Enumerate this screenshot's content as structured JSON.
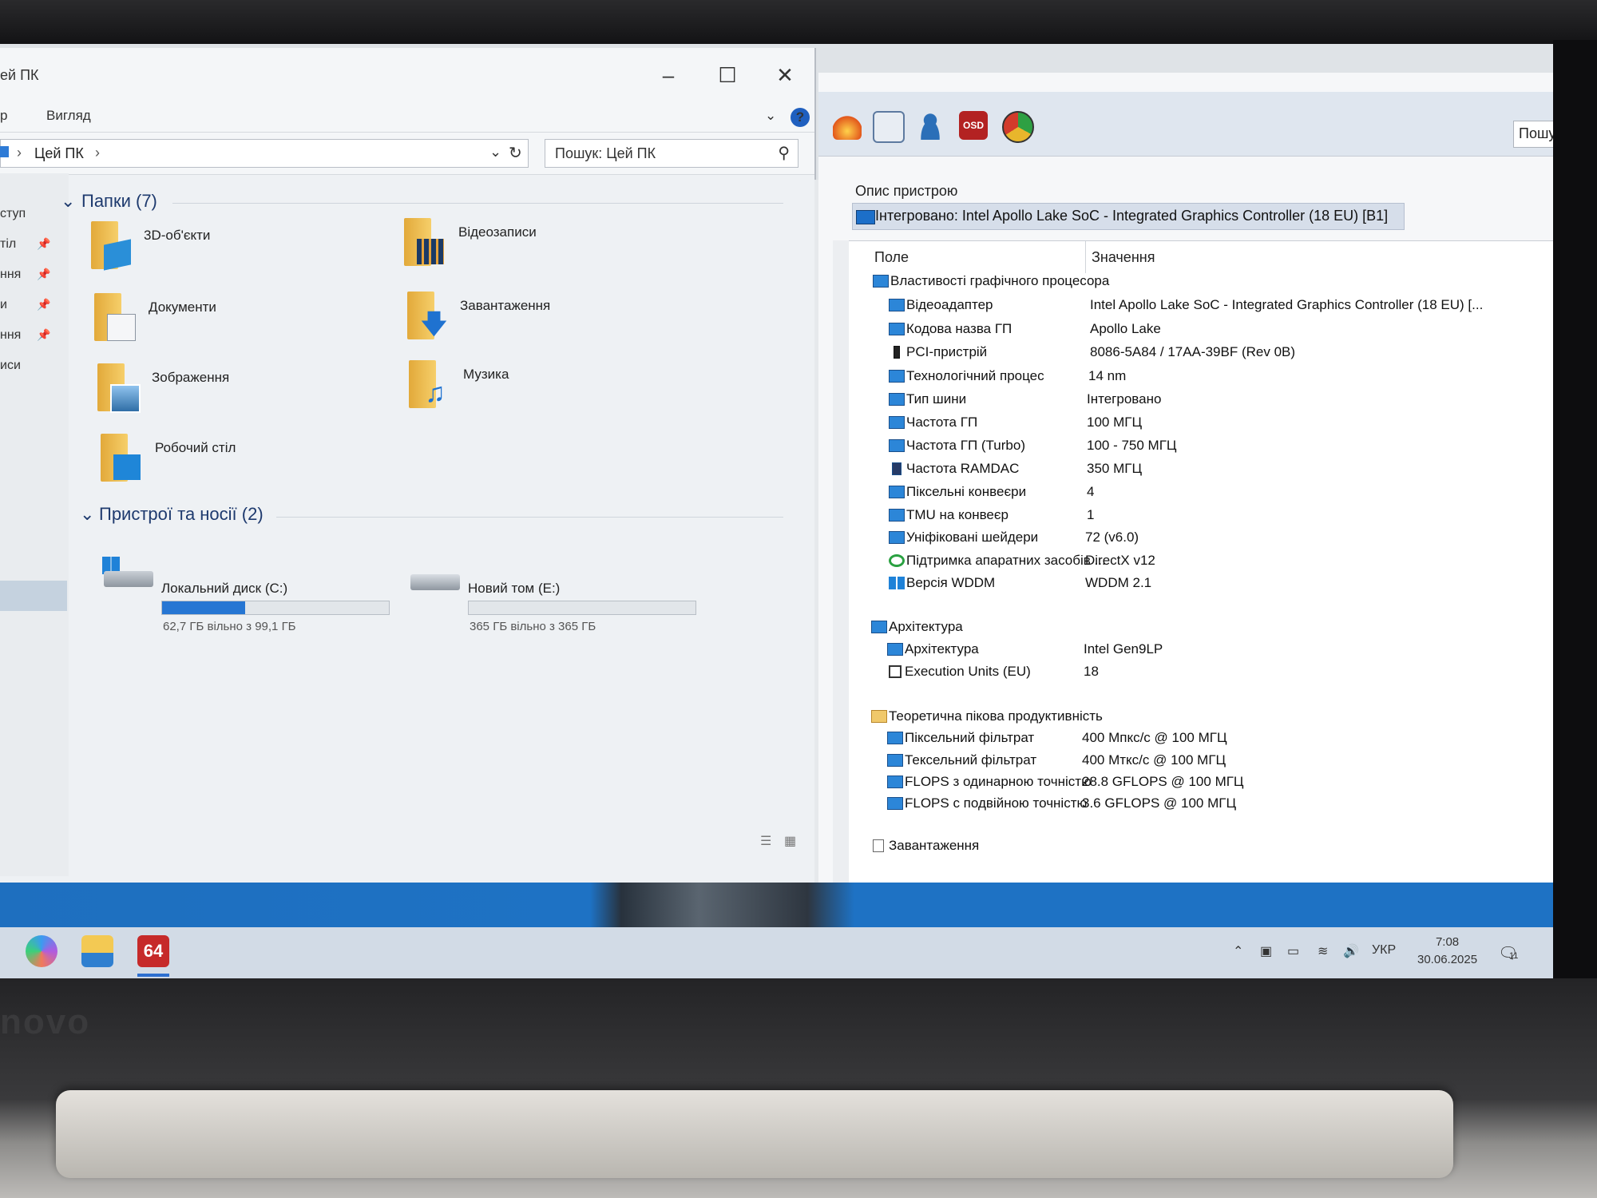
{
  "explorer": {
    "title": "ей ПК",
    "ribbon": {
      "left": "р",
      "view": "Вигляд"
    },
    "address": {
      "crumb": "Цей ПК"
    },
    "search": {
      "placeholder": "Пошук: Цей ПК"
    },
    "nav": [
      {
        "label": "ступ",
        "pinned": false
      },
      {
        "label": "тіл",
        "pinned": true
      },
      {
        "label": "ння",
        "pinned": true
      },
      {
        "label": "и",
        "pinned": true
      },
      {
        "label": "ння",
        "pinned": true
      },
      {
        "label": "иси",
        "pinned": false
      }
    ],
    "folders_header": "Папки (7)",
    "folders": [
      {
        "label": "3D-об'єкти",
        "icon": "3d-objects-icon"
      },
      {
        "label": "Відеозаписи",
        "icon": "videos-icon"
      },
      {
        "label": "Документи",
        "icon": "documents-icon"
      },
      {
        "label": "Завантаження",
        "icon": "downloads-icon"
      },
      {
        "label": "Зображення",
        "icon": "pictures-icon"
      },
      {
        "label": "Музика",
        "icon": "music-icon"
      },
      {
        "label": "Робочий стіл",
        "icon": "desktop-icon"
      }
    ],
    "devices_header": "Пристрої та носії (2)",
    "drives": [
      {
        "label": "Локальний диск (C:)",
        "free": "62,7 ГБ вільно з 99,1 ГБ",
        "used_fraction": 0.367
      },
      {
        "label": "Новий том (E:)",
        "free": "365 ГБ вільно з 365 ГБ",
        "used_fraction": 0.0
      }
    ]
  },
  "aida": {
    "search_label": "Пошук",
    "toolbar_icons": [
      "flame-icon",
      "report-icon",
      "user-icon",
      "osd-icon",
      "gauge-icon"
    ],
    "osd_label": "OSD",
    "device_description_label": "Опис пристрою",
    "device_description": "Інтегровано: Intel Apollo Lake SoC - Integrated Graphics Controller (18 EU) [B1]",
    "columns": {
      "field": "Поле",
      "value": "Значення"
    },
    "sections": [
      {
        "title": "Властивості графічного процесора",
        "rows": [
          {
            "k": "Відеоадаптер",
            "v": "Intel Apollo Lake SoC - Integrated Graphics Controller (18 EU) [..."
          },
          {
            "k": "Кодова назва ГП",
            "v": "Apollo Lake"
          },
          {
            "k": "PCI-пристрій",
            "v": "8086-5A84 / 17AA-39BF  (Rev 0B)"
          },
          {
            "k": "Технологічний процес",
            "v": "14 nm"
          },
          {
            "k": "Тип шини",
            "v": "Інтегровано"
          },
          {
            "k": "Частота ГП",
            "v": "100 МГЦ"
          },
          {
            "k": "Частота ГП (Turbo)",
            "v": "100 - 750 МГЦ"
          },
          {
            "k": "Частота RAMDAC",
            "v": "350 МГЦ"
          },
          {
            "k": "Піксельні конвеєри",
            "v": "4"
          },
          {
            "k": "TMU на конвеєр",
            "v": "1"
          },
          {
            "k": "Уніфіковані шейдери",
            "v": "72  (v6.0)"
          },
          {
            "k": "Підтримка апаратних засобів ...",
            "v": "DirectX v12"
          },
          {
            "k": "Версія WDDM",
            "v": "WDDM 2.1"
          }
        ]
      },
      {
        "title": "Архітектура",
        "rows": [
          {
            "k": "Архітектура",
            "v": "Intel Gen9LP"
          },
          {
            "k": "Execution Units (EU)",
            "v": "18"
          }
        ]
      },
      {
        "title": "Теоретична пікова продуктивність",
        "rows": [
          {
            "k": "Піксельний фільтрат",
            "v": "400 Мпкс/с @ 100 МГЦ"
          },
          {
            "k": "Тексельний фільтрат",
            "v": "400 Мткс/с @ 100 МГЦ"
          },
          {
            "k": "FLOPS з одинарною точністю",
            "v": "28.8 GFLOPS @ 100 МГЦ"
          },
          {
            "k": "FLOPS с подвійною точністю",
            "v": "3.6 GFLOPS @ 100 МГЦ"
          }
        ]
      },
      {
        "title": "Завантаження",
        "rows": []
      }
    ]
  },
  "taskbar": {
    "aida_badge": "64",
    "language": "УКР",
    "time": "7:08",
    "date": "30.06.2025",
    "notifications": "11"
  },
  "brand": "novo"
}
